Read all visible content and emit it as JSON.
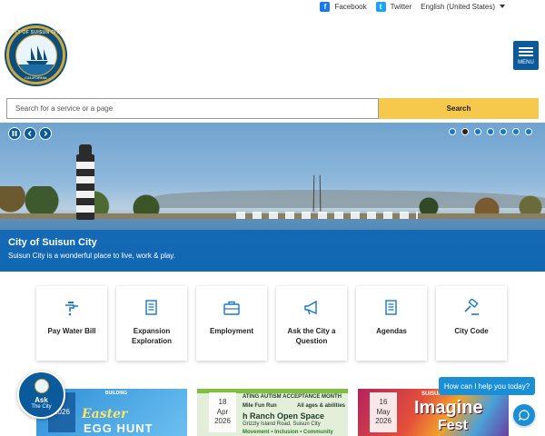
{
  "header": {
    "facebook_label": "Facebook",
    "twitter_label": "Twitter",
    "language_label": "English (United States)",
    "logo_text_top": "CITY OF SUISUN CITY",
    "logo_text_bottom": "CALIFORNIA",
    "menu_label": "MENU"
  },
  "search": {
    "placeholder": "Search for a service or a page",
    "button_label": "Search"
  },
  "hero": {
    "title": "City of Suisun City",
    "subtitle": "Suisun City is a wonderful place to live, work & play.",
    "slide_count": 7,
    "active_slide": 2
  },
  "quick_links": [
    {
      "label": "Pay Water Bill",
      "icon": "water-faucet-icon"
    },
    {
      "label": "Expansion Exploration",
      "icon": "document-icon"
    },
    {
      "label": "Employment",
      "icon": "briefcase-icon"
    },
    {
      "label": "Ask the City a Question",
      "icon": "megaphone-icon"
    },
    {
      "label": "Agendas",
      "icon": "document-icon"
    },
    {
      "label": "City Code",
      "icon": "gavel-icon"
    }
  ],
  "events": [
    {
      "year": "2026",
      "title": "Easter",
      "title2": "EGG HUNT",
      "tag": "BUILDING"
    },
    {
      "day": "18",
      "month": "Apr",
      "year": "2026",
      "line1": "ATING AUTISM ACCEPTANCE MONTH",
      "line2": "Mile Fun Run",
      "line2b": "All ages & abilities",
      "line3": "h Ranch Open Space",
      "line4": "Grizzly Island Road, Suisun City",
      "line5": "Movement • Inclusion • Community"
    },
    {
      "day": "16",
      "month": "May",
      "year": "2026",
      "sub": "SUISUN CITY",
      "title": "Imagine",
      "title2": "Fest"
    }
  ],
  "ask_widget": {
    "line1": "Ask",
    "line2": "The City"
  },
  "chat": {
    "prompt": "How can I help you today?"
  },
  "colors": {
    "primary_blue": "#0b5a9c",
    "search_yellow": "#f6c94c",
    "caption_blue": "#0b64b4"
  }
}
